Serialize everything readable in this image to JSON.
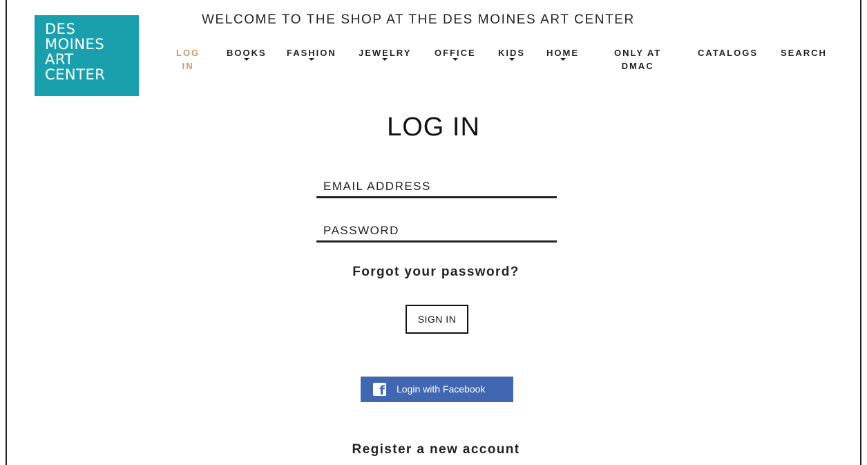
{
  "brand": {
    "logo_lines": [
      "DES",
      "MOINES",
      "ART",
      "CENTER"
    ],
    "color": "#1aa0ad"
  },
  "header": {
    "welcome": "WELCOME TO THE SHOP AT THE DES MOINES ART CENTER"
  },
  "nav": {
    "items": [
      {
        "line1": "LOG",
        "line2": "IN",
        "dropdown": false,
        "active": true
      },
      {
        "line1": "BOOKS",
        "line2": "",
        "dropdown": true
      },
      {
        "line1": "FASHION",
        "line2": "",
        "dropdown": true
      },
      {
        "line1": "JEWELRY",
        "line2": "",
        "dropdown": true
      },
      {
        "line1": "OFFICE",
        "line2": "",
        "dropdown": true
      },
      {
        "line1": "KIDS",
        "line2": "",
        "dropdown": true
      },
      {
        "line1": "HOME",
        "line2": "",
        "dropdown": true
      },
      {
        "line1": "ONLY AT",
        "line2": "DMAC",
        "dropdown": false
      },
      {
        "line1": "CATALOGS",
        "line2": "",
        "dropdown": false
      },
      {
        "line1": "SEARCH",
        "line2": "",
        "dropdown": false
      }
    ],
    "active_color": "#c59a6c"
  },
  "login": {
    "title": "LOG IN",
    "email_placeholder": "EMAIL ADDRESS",
    "email_value": "",
    "password_placeholder": "PASSWORD",
    "password_value": "",
    "forgot_link": "Forgot your password?",
    "sign_in_label": "SIGN IN",
    "facebook_label": "Login with Facebook",
    "facebook_color": "#4267b2",
    "register_link": "Register a new account"
  }
}
